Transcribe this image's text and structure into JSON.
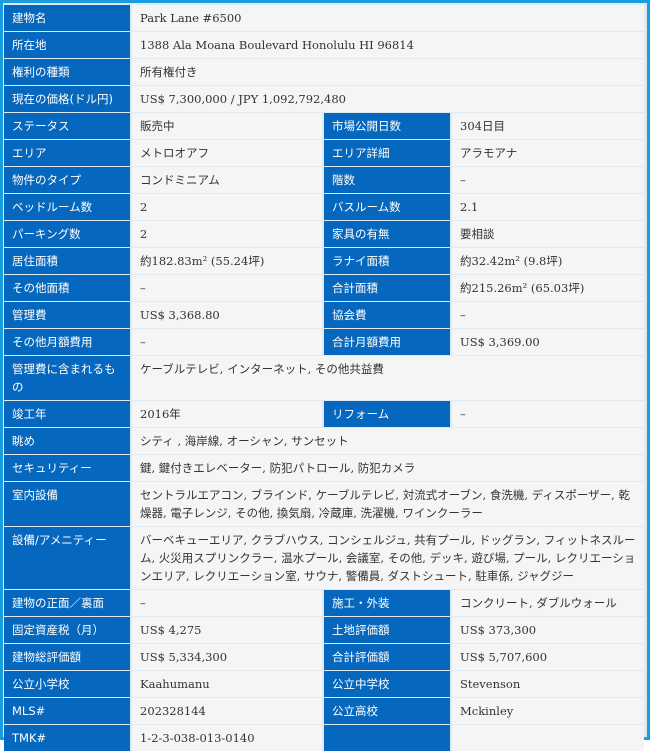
{
  "property": {
    "rows": [
      {
        "type": "full",
        "label": "建物名",
        "value": "Park Lane #6500"
      },
      {
        "type": "full",
        "label": "所在地",
        "value": "1388 Ala Moana Boulevard Honolulu HI 96814"
      },
      {
        "type": "full",
        "label": "権利の種類",
        "value": "所有権付き"
      },
      {
        "type": "full",
        "label": "現在の価格(ドル円)",
        "value": "US$ 7,300,000 / JPY 1,092,792,480"
      },
      {
        "type": "pair",
        "label": "ステータス",
        "value": "販売中",
        "label2": "市場公開日数",
        "value2": "304日目"
      },
      {
        "type": "pair",
        "label": "エリア",
        "value": "メトロオアフ",
        "label2": "エリア詳細",
        "value2": "アラモアナ"
      },
      {
        "type": "pair",
        "label": "物件のタイプ",
        "value": "コンドミニアム",
        "label2": "階数",
        "value2": "–"
      },
      {
        "type": "pair",
        "label": "ベッドルーム数",
        "value": "2",
        "label2": "バスルーム数",
        "value2": "2.1"
      },
      {
        "type": "pair",
        "label": "パーキング数",
        "value": "2",
        "label2": "家具の有無",
        "value2": "要相談"
      },
      {
        "type": "pair",
        "label": "居住面積",
        "value": "約182.83m² (55.24坪)",
        "label2": "ラナイ面積",
        "value2": "約32.42m² (9.8坪)"
      },
      {
        "type": "pair",
        "label": "その他面積",
        "value": "–",
        "label2": "合計面積",
        "value2": "約215.26m² (65.03坪)"
      },
      {
        "type": "pair",
        "label": "管理費",
        "value": "US$ 3,368.80",
        "label2": "協会費",
        "value2": "–"
      },
      {
        "type": "pair",
        "label": "その他月額費用",
        "value": "–",
        "label2": "合計月額費用",
        "value2": "US$ 3,369.00"
      },
      {
        "type": "full",
        "label": "管理費に含まれるもの",
        "value": "ケーブルテレビ, インターネット, その他共益費"
      },
      {
        "type": "pair",
        "label": "竣工年",
        "value": "2016年",
        "label2": "リフォーム",
        "value2": "–"
      },
      {
        "type": "full",
        "label": "眺め",
        "value": "シティ , 海岸線, オーシャン, サンセット"
      },
      {
        "type": "full",
        "label": "セキュリティー",
        "value": "鍵, 鍵付きエレベーター, 防犯パトロール, 防犯カメラ"
      },
      {
        "type": "full",
        "label": "室内設備",
        "value": "セントラルエアコン, ブラインド, ケーブルテレビ, 対流式オーブン, 食洗機, ディスポーザー, 乾燥器, 電子レンジ, その他, 換気扇, 冷蔵庫, 洗濯機, ワインクーラー"
      },
      {
        "type": "full",
        "label": "設備/アメニティー",
        "value": "バーベキューエリア, クラブハウス, コンシェルジュ, 共有プール, ドッグラン, フィットネスルーム, 火災用スプリンクラー, 温水プール, 会議室, その他, デッキ, 遊び場, プール, レクリエーションエリア, レクリエーション室, サウナ, 警備員, ダストシュート, 駐車係, ジャグジー"
      },
      {
        "type": "pair",
        "label": "建物の正面／裏面",
        "value": "–",
        "label2": "施工・外装",
        "value2": "コンクリート, ダブルウォール"
      },
      {
        "type": "pair",
        "label": "固定資産税（月）",
        "value": "US$ 4,275",
        "label2": "土地評価額",
        "value2": "US$ 373,300"
      },
      {
        "type": "pair",
        "label": "建物総評価額",
        "value": "US$ 5,334,300",
        "label2": "合計評価額",
        "value2": "US$ 5,707,600"
      },
      {
        "type": "pair",
        "label": "公立小学校",
        "value": "Kaahumanu",
        "label2": "公立中学校",
        "value2": "Stevenson"
      },
      {
        "type": "pair",
        "label": "MLS#",
        "value": "202328144",
        "label2": "公立高校",
        "value2": "Mckinley"
      },
      {
        "type": "pair",
        "label": "TMK#",
        "value": "1-2-3-038-013-0140",
        "label2": "",
        "value2": ""
      }
    ]
  }
}
